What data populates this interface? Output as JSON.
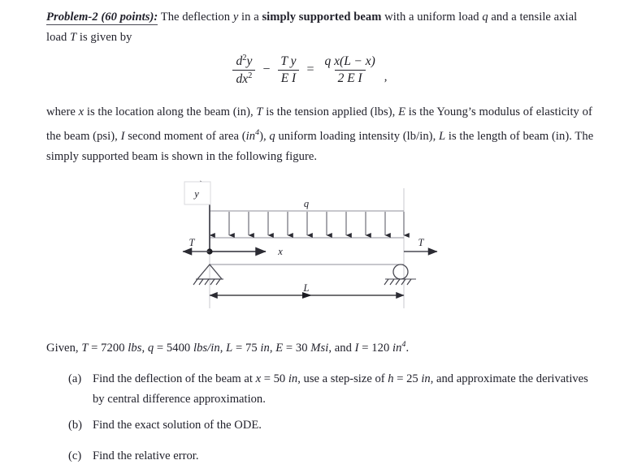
{
  "document": {
    "problem_title": "Problem-2 (60 points):",
    "intro_before_bold": " The deflection ",
    "intro_var_y": "y",
    "intro_mid": " in a ",
    "intro_bold": "simply supported beam",
    "intro_after_bold": " with a uniform load ",
    "intro_var_q": "q",
    "intro_tail": " and a tensile axial load ",
    "intro_var_T": "T",
    "intro_end": " is given by",
    "equation": {
      "lhs_num": "d²y",
      "lhs_den": "dx²",
      "minus": "−",
      "term2_num": "T y",
      "term2_den": "E I",
      "equals": "=",
      "rhs_num": "q x(L − x)",
      "rhs_den": "2 E I",
      "trailing_comma": ","
    },
    "where_paragraph": {
      "s1": "where ",
      "v_x": "x",
      "s2": " is the location along the beam (in), ",
      "v_T": "T",
      "s3": " is the tension applied (lbs), ",
      "v_E": "E",
      "s4": " is the Young’s modulus of elasticity of the beam (psi), ",
      "v_I": "I",
      "s5": " second moment of area (",
      "unit_in4": "in",
      "unit_in4_exp": "4",
      "s6": "), ",
      "v_q": "q",
      "s7": " uniform loading intensity (lb/in), ",
      "v_L": "L",
      "s8": " is the length of beam (in). The simply supported beam is shown in the following figure."
    },
    "given": {
      "lead": "Given, ",
      "T_label": "T",
      "T_eq": " = 7200 ",
      "T_unit": "lbs",
      "sep1": ", ",
      "q_label": "q",
      "q_eq": " = 5400 ",
      "q_unit": "lbs/in",
      "sep2": ", ",
      "L_label": "L",
      "L_eq": " = 75 ",
      "L_unit": "in",
      "sep3": ", ",
      "E_label": "E",
      "E_eq": " = 30 ",
      "E_unit": "Msi",
      "sep4": ", and ",
      "I_label": "I",
      "I_eq": " = 120 ",
      "I_unit": "in",
      "I_unit_exp": "4",
      "period": "."
    },
    "items": [
      {
        "label": "(a)",
        "p1": "Find the deflection of the beam at ",
        "v1": "x",
        "p2": " = 50 ",
        "u1": "in",
        "p3": ", use a step-size of ",
        "v2": "h",
        "p4": " = 25 ",
        "u2": "in",
        "p5": ", and approximate the derivatives by central difference approximation."
      },
      {
        "label": "(b)",
        "p1": "Find the exact solution of the ODE."
      },
      {
        "label": "(c)",
        "p1": "Find the relative error."
      }
    ]
  },
  "figure": {
    "label_y": "y",
    "label_x": "x",
    "label_q": "q",
    "label_L": "L",
    "label_T_left": "T",
    "label_T_right": "T",
    "support_left_type": "pinned-triangle",
    "support_right_type": "roller-circle",
    "load_arrow_count": 9,
    "colors": {
      "line": "#2b2b33",
      "light_line": "#8f8f99",
      "extension_line": "#c9c9cf",
      "text": "#21212b"
    }
  }
}
